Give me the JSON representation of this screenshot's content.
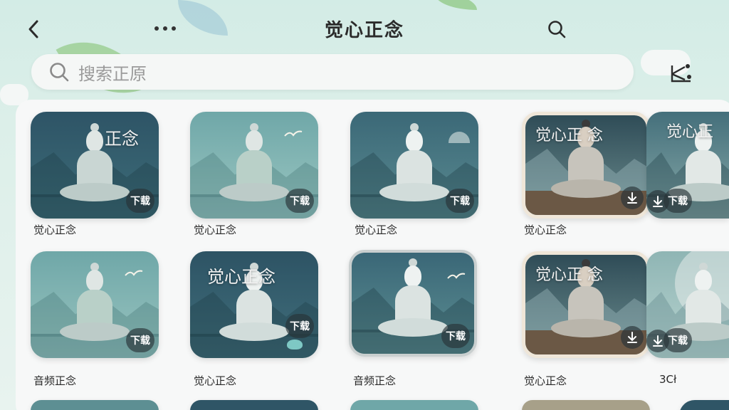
{
  "header": {
    "title": "觉心正念"
  },
  "search": {
    "placeholder": "搜索正原"
  },
  "grid": {
    "row1": [
      {
        "overlay": "正念",
        "badge": "下载",
        "caption": "觉心正念"
      },
      {
        "overlay": "",
        "badge": "下载",
        "caption": "觉心正念"
      },
      {
        "overlay": "",
        "badge": "下载",
        "caption": "觉心正念"
      },
      {
        "overlay": "觉心正 念",
        "badge": "",
        "caption": "觉心正念"
      },
      {
        "overlay": "觉心正",
        "badge": "下载",
        "caption": ""
      }
    ],
    "row2": [
      {
        "overlay": "",
        "badge": "下载",
        "caption": "音频正念"
      },
      {
        "overlay": "觉心正念",
        "badge": "下载",
        "caption": "觉心正念"
      },
      {
        "overlay": "",
        "badge": "下载",
        "caption": "音频正念"
      },
      {
        "overlay": "觉心正 念",
        "badge": "",
        "caption": "觉心正念"
      },
      {
        "overlay": "",
        "badge": "下载",
        "caption": "3Cł"
      }
    ]
  },
  "colors": {
    "accent_bg": "#d3ece6",
    "card_dark": "#2f5566",
    "card_light": "#6fa7a8",
    "paper": "#efe6d8"
  },
  "icons": [
    "back-arrow-icon",
    "more-dots-icon",
    "search-icon",
    "share-icon",
    "download-icon"
  ]
}
